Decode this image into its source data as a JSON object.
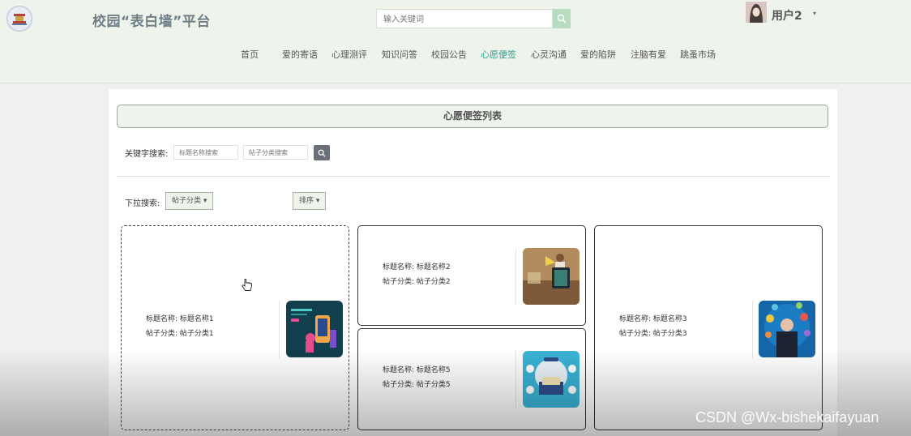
{
  "header": {
    "site_title": "校园“表白墙”平台",
    "search_placeholder": "输入关键词",
    "username": "用户2",
    "user_caret": "▾"
  },
  "nav": [
    {
      "label": "首页"
    },
    {
      "label": "爱的寄语"
    },
    {
      "label": "心理测评"
    },
    {
      "label": "知识问答"
    },
    {
      "label": "校园公告"
    },
    {
      "label": "心愿便签",
      "active": true
    },
    {
      "label": "心灵沟通"
    },
    {
      "label": "爱的陷阱"
    },
    {
      "label": "注脑有爱"
    },
    {
      "label": "跳蚤市场"
    }
  ],
  "main": {
    "list_title": "心愿便签列表",
    "keyword_label": "关键字搜索:",
    "title_search_placeholder": "标题名称搜索",
    "category_search_placeholder": "帖子分类搜索",
    "dropdown_label": "下拉搜索:",
    "category_dropdown": "帖子分类 ▾",
    "sort_dropdown": "排序 ▾"
  },
  "cards": [
    {
      "title_line": "标题名称: 标题名称1",
      "category_line": "帖子分类: 帖子分类1"
    },
    {
      "title_line": "标题名称: 标题名称2",
      "category_line": "帖子分类: 帖子分类2"
    },
    {
      "title_line": "标题名称: 标题名称3",
      "category_line": "帖子分类: 帖子分类3"
    },
    {
      "title_line": "标题名称: 标题名称5",
      "category_line": "帖子分类: 帖子分类5"
    }
  ],
  "watermark": "CSDN @Wx-bishekaifayuan",
  "colors": {
    "header_bg": "#eef3ec",
    "accent": "#2e9c8d",
    "search_btn": "#b9dcc0"
  }
}
